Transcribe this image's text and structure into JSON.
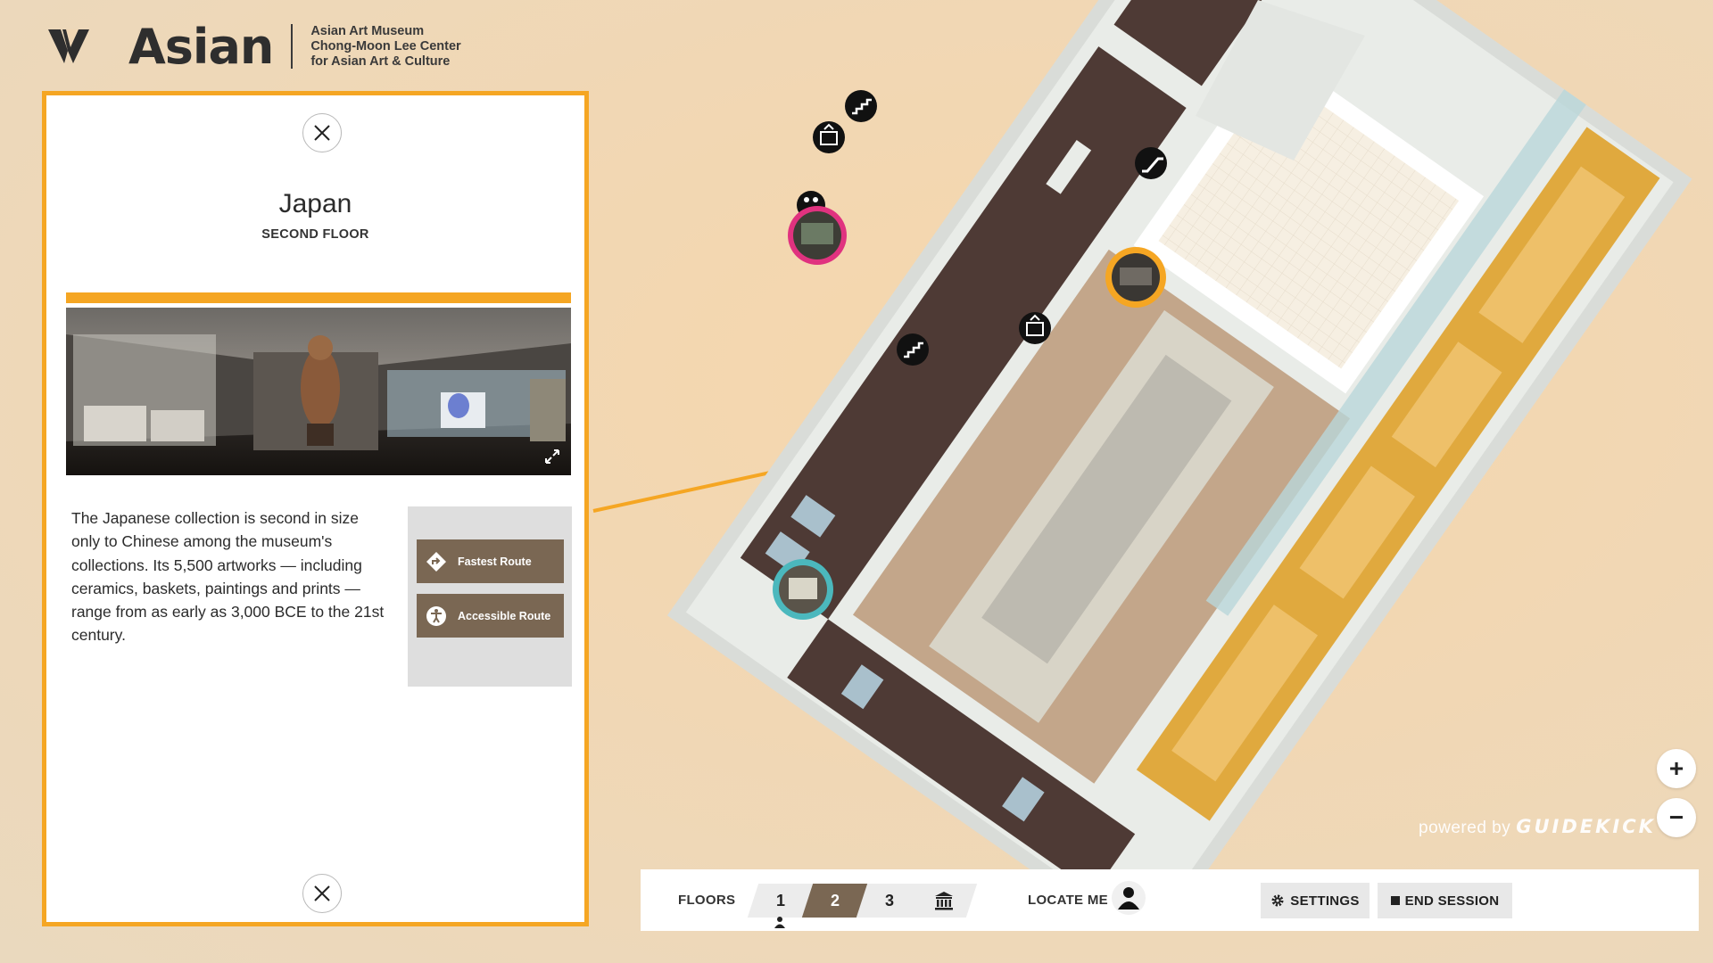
{
  "header": {
    "brand": "Asian",
    "subtitle_lines": [
      "Asian Art Museum",
      "Chong-Moon Lee Center",
      "for Asian Art & Culture"
    ]
  },
  "panel": {
    "title": "Japan",
    "floor": "SECOND FLOOR",
    "description": "The Japanese collection is second in size only to Chinese among the museum's collections. Its 5,500 artworks —   including ceramics, baskets, paintings and prints — range from as early as 3,000 BCE to the 21st century.",
    "routes": {
      "fastest": "Fastest Route",
      "accessible": "Accessible Route"
    },
    "accent_color": "#f5a623"
  },
  "map": {
    "markers": [
      {
        "name": "japan-gallery",
        "color": "#f5a623"
      },
      {
        "name": "gallery-pink",
        "color": "#e0327f"
      },
      {
        "name": "gallery-teal",
        "color": "#4bb8bd"
      }
    ],
    "icons": [
      "stairs-icon",
      "elevator-icon",
      "restroom-icon",
      "escalator-icon"
    ]
  },
  "powered_by": {
    "prefix": "powered by",
    "brand": "GUIDEKICK"
  },
  "zoom": {
    "in": "+",
    "out": "−"
  },
  "bottom_bar": {
    "floors_label": "FLOORS",
    "floors": [
      "1",
      "2",
      "3"
    ],
    "active_floor": "2",
    "locate_label": "LOCATE ME",
    "settings_label": "SETTINGS",
    "end_session_label": "END SESSION",
    "active_color": "#7a6753"
  }
}
